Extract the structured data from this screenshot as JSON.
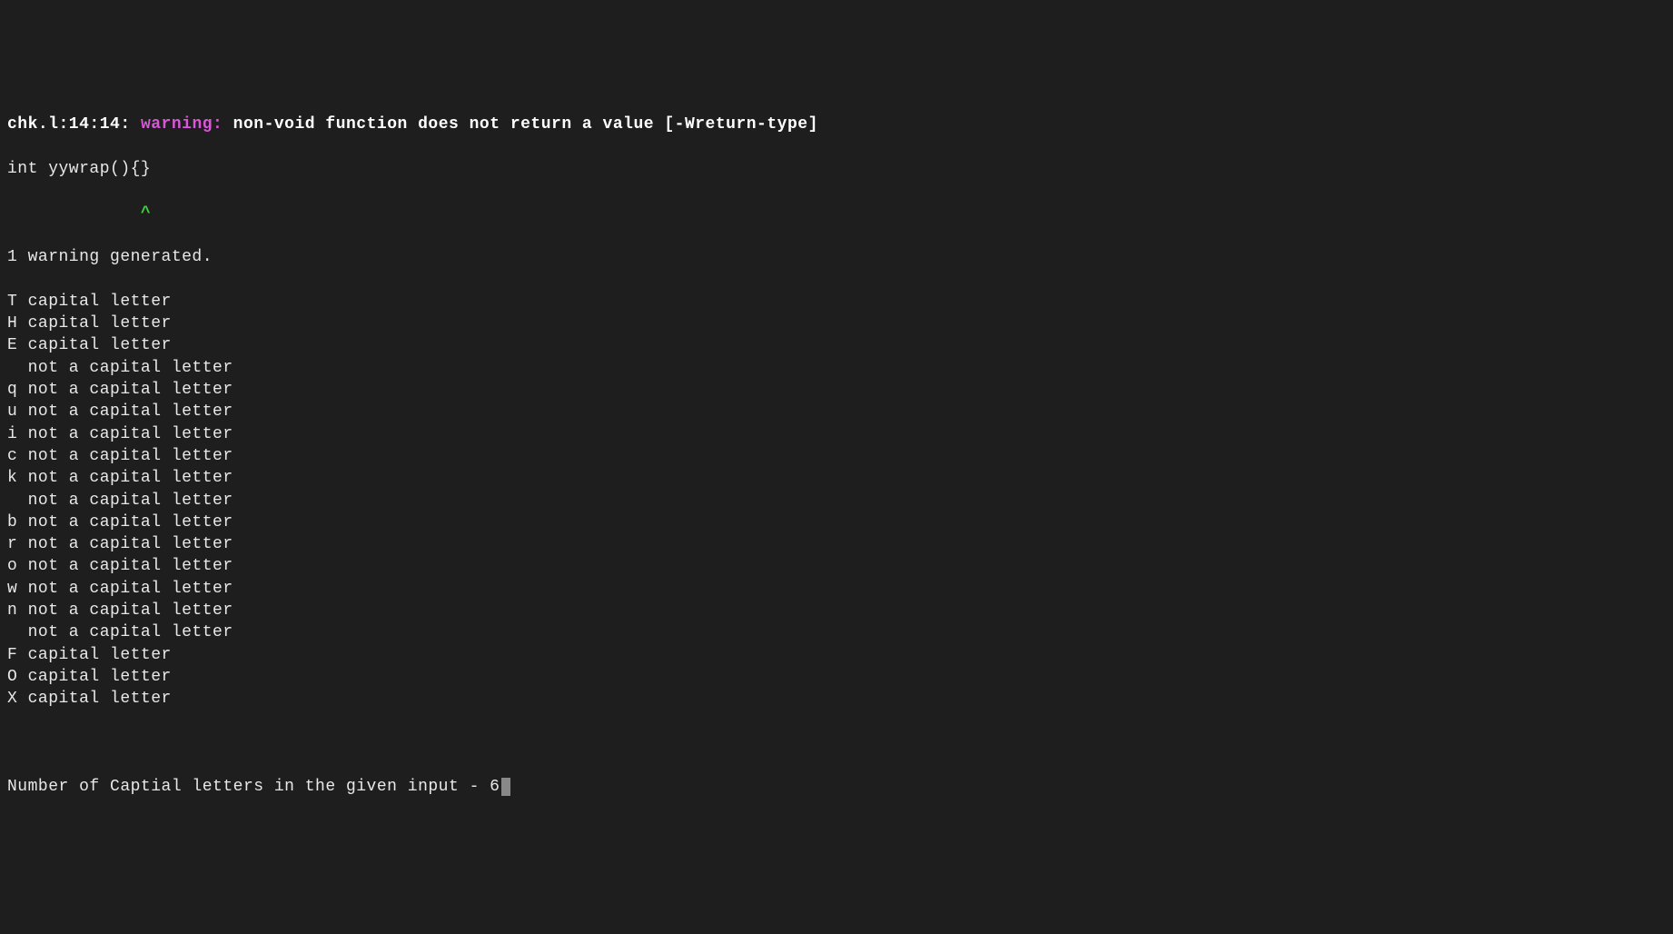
{
  "compiler": {
    "location": "chk.l:14:14:",
    "warning_keyword": "warning:",
    "warning_message": "non-void function does not return a value [-Wreturn-type]",
    "code_line": "int yywrap(){}",
    "caret_line": "             ^"
  },
  "output": {
    "summary": "1 warning generated.",
    "lines": [
      "T capital letter",
      "H capital letter",
      "E capital letter",
      "  not a capital letter",
      "q not a capital letter",
      "u not a capital letter",
      "i not a capital letter",
      "c not a capital letter",
      "k not a capital letter",
      "  not a capital letter",
      "b not a capital letter",
      "r not a capital letter",
      "o not a capital letter",
      "w not a capital letter",
      "n not a capital letter",
      "  not a capital letter",
      "F capital letter",
      "O capital letter",
      "X capital letter"
    ],
    "blank": "",
    "result": "Number of Captial letters in the given input - 6"
  }
}
